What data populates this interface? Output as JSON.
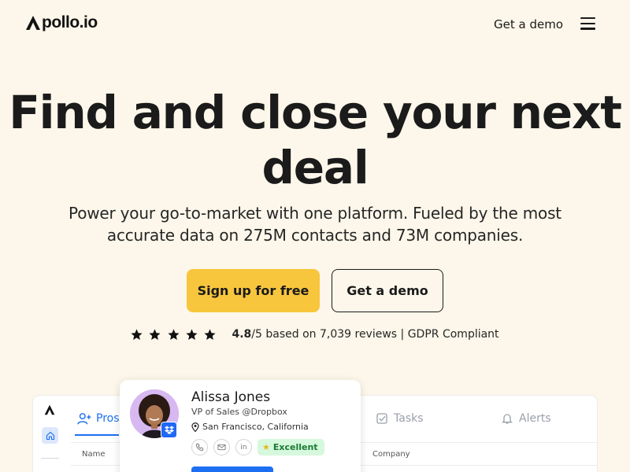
{
  "header": {
    "logo_text": "pollo.io",
    "logo_full": "Apollo.io",
    "demo_link": "Get a demo",
    "menu_icon": "hamburger-menu-icon"
  },
  "hero": {
    "title": "Find and close your next deal",
    "subtitle": "Power your go-to-market with one platform. Fueled by the most accurate data on 275M contacts and 73M companies.",
    "signup_button": "Sign up for free",
    "demo_button": "Get a demo"
  },
  "rating": {
    "stars": 5,
    "score": "4.8",
    "text": "/5 based on 7,039 reviews | GDPR Compliant"
  },
  "app_preview": {
    "tabs": [
      "Pros",
      "Tasks",
      "Alerts"
    ],
    "columns": [
      "Name",
      "Company"
    ]
  },
  "profile_card": {
    "name": "Alissa Jones",
    "title": "VP of Sales @Dropbox",
    "location": "San Francisco, California",
    "rating_badge": "Excellent",
    "linkedin_label": "in"
  },
  "colors": {
    "background": "#fcf7ea",
    "primary_button": "#f8c63d",
    "accent_blue": "#1d6ff2",
    "badge_green": "#d6f8dc"
  }
}
